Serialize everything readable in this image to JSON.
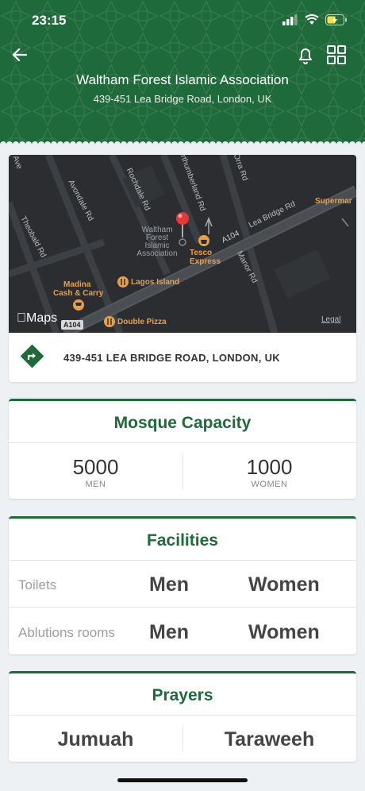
{
  "status_bar": {
    "time": "23:15"
  },
  "header": {
    "title": "Waltham Forest Islamic Association",
    "subtitle": "439-451 Lea Bridge Road, London, UK"
  },
  "map": {
    "street_labels": [
      "Ave",
      "Avondale Rd",
      "Rochdale Rd",
      "Northumberland Rd",
      "Orra Rd",
      "Theobald Rd",
      "Lea Bridge Rd",
      "Manor Rd"
    ],
    "road_shield": "A104",
    "road_label": "A104",
    "pois": {
      "assoc_line1": "Waltham",
      "assoc_line2": "Forest",
      "assoc_line3": "Islamic",
      "assoc_line4": "Association",
      "tesco_line1": "Tesco",
      "tesco_line2": "Express",
      "madina_line1": "Madina",
      "madina_line2": "Cash & Carry",
      "lagos": "Lagos Island",
      "pizza": "Double Pizza",
      "super": "Supermar"
    },
    "maps_brand": "Maps",
    "legal": "Legal"
  },
  "address": "439-451 LEA BRIDGE ROAD, LONDON, UK",
  "capacity": {
    "title": "Mosque Capacity",
    "men_value": "5000",
    "men_label": "MEN",
    "women_value": "1000",
    "women_label": "WOMEN"
  },
  "facilities": {
    "title": "Facilities",
    "rows": [
      {
        "label": "Toilets",
        "men": "Men",
        "women": "Women"
      },
      {
        "label": "Ablutions rooms",
        "men": "Men",
        "women": "Women"
      }
    ]
  },
  "prayers": {
    "title": "Prayers",
    "items": [
      "Jumuah",
      "Taraweeh"
    ]
  },
  "colors": {
    "brand_green": "#1f6a3a",
    "map_bg": "#2b2d30",
    "poi_orange": "#e7a04a",
    "pin_red": "#e53935"
  }
}
